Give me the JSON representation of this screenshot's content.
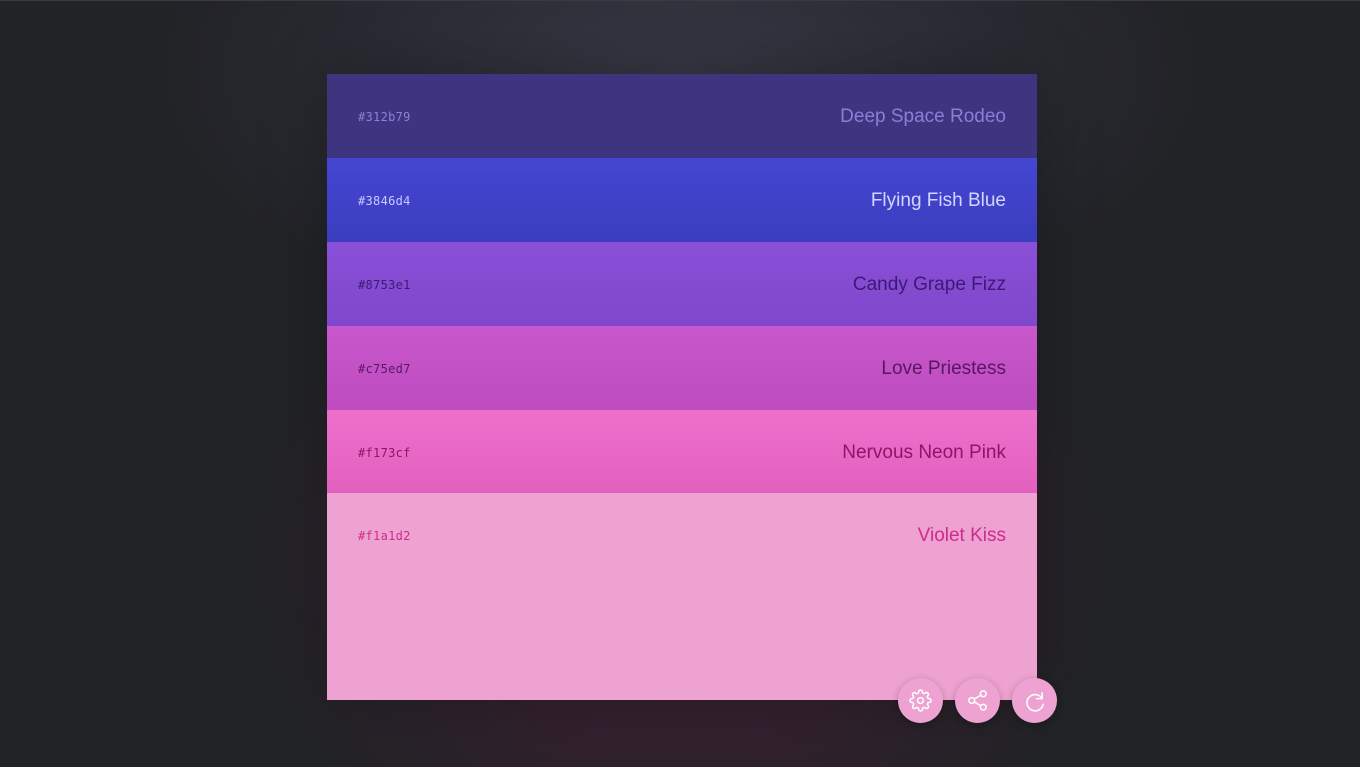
{
  "palette": {
    "colors": [
      {
        "hex": "#312b79",
        "name": "Deep Space Rodeo"
      },
      {
        "hex": "#3846d4",
        "name": "Flying Fish Blue"
      },
      {
        "hex": "#8753e1",
        "name": "Candy Grape Fizz"
      },
      {
        "hex": "#c75ed7",
        "name": "Love Priestess"
      },
      {
        "hex": "#f173cf",
        "name": "Nervous Neon Pink"
      },
      {
        "hex": "#f1a1d2",
        "name": "Violet Kiss"
      }
    ]
  },
  "actions": {
    "settings_icon": "gear-icon",
    "share_icon": "share-icon",
    "refresh_icon": "refresh-icon",
    "button_color": "#eea2d1",
    "icon_color": "#ffffff"
  },
  "background_color": "#222327"
}
